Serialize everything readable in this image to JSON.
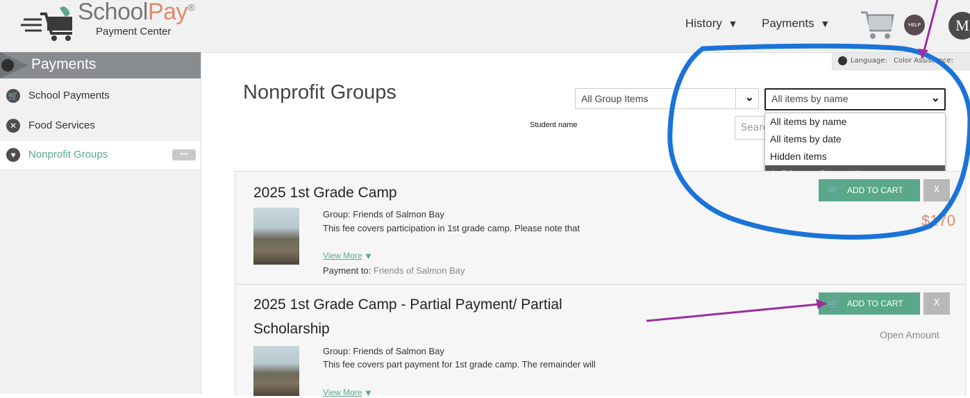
{
  "header": {
    "logo_main": "School",
    "logo_accent": "Pay",
    "logo_reg": "®",
    "logo_sub": "Payment Center",
    "nav": [
      {
        "label": "History",
        "chevron": "▾"
      },
      {
        "label": "Payments",
        "chevron": "▾"
      }
    ],
    "help_label": "HELP",
    "avatar_initial": "M"
  },
  "language_bar": {
    "language_label": "Language:",
    "color_label": "Color Assistance:"
  },
  "sidebar": {
    "title": "Payments",
    "items": [
      {
        "label": "School Payments",
        "icon": "cart-icon"
      },
      {
        "label": "Food Services",
        "icon": "utensils-icon"
      },
      {
        "label": "Nonprofit Groups",
        "icon": "heart-icon",
        "active": true,
        "badge": "•••"
      }
    ]
  },
  "main": {
    "title": "Nonprofit Groups",
    "group_filter": {
      "value": "All Group Items"
    },
    "sort_filter": {
      "value": "All items by name"
    },
    "student_label": "Student name",
    "search": {
      "placeholder": "Search"
    },
    "dropdown_options": [
      "All items by name",
      "All items by date",
      "Hidden items",
      "Aoibheann Stewart Items"
    ],
    "dropdown_selected_index": 3
  },
  "items": [
    {
      "title": "2025 1st Grade Camp",
      "group": "Group: Friends of Salmon Bay",
      "description": "This fee covers participation in 1st grade camp.  Please note that",
      "view_more": "View More",
      "payment_to_label": "Payment to:",
      "payment_to": "Friends of Salmon Bay",
      "price": "$170",
      "add_to_cart": "ADD TO CART",
      "hide": "X"
    },
    {
      "title_line1": "2025 1st Grade Camp - Partial Payment/ Partial",
      "title_line2": "Scholarship",
      "group": "Group: Friends of Salmon Bay",
      "description": "This fee covers part payment for 1st grade camp.  The remainder will",
      "view_more": "View More",
      "price": "Open Amount",
      "add_to_cart": "ADD TO CART",
      "hide": "X"
    }
  ],
  "annotation_colors": {
    "circle": "#1a73d9",
    "arrow": "#9b2fa0"
  }
}
